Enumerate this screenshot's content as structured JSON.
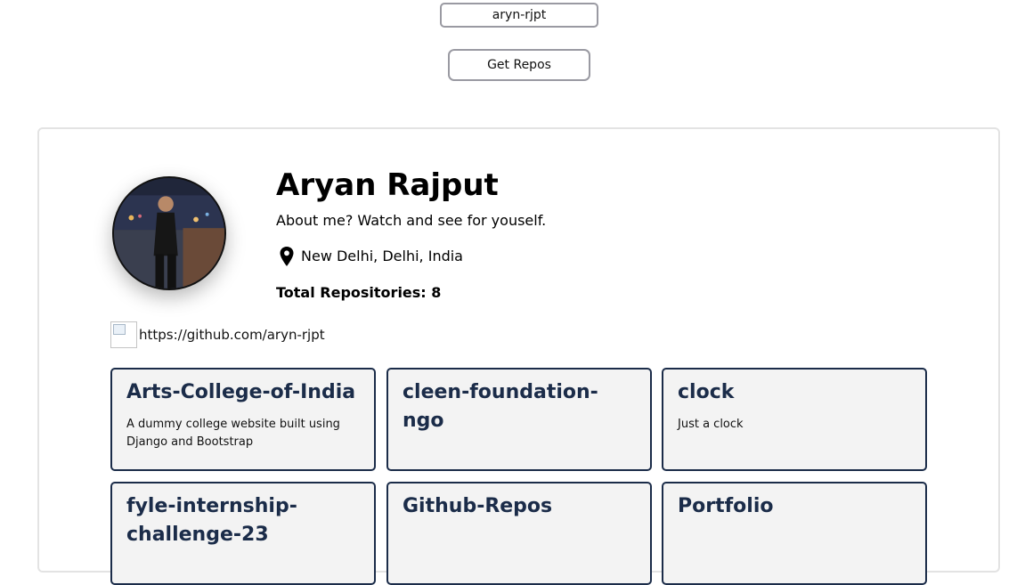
{
  "search": {
    "value": "aryn-rjpt"
  },
  "get_repos_button": {
    "label": "Get Repos"
  },
  "profile": {
    "name": "Aryan Rajput",
    "bio": "About me? Watch and see for youself.",
    "location": "New Delhi, Delhi, India",
    "total_repos": "Total Repositories: 8",
    "github_url": "https://github.com/aryn-rjpt"
  },
  "repos": [
    {
      "name": "Arts-College-of-India",
      "description": "A dummy college website built using Django and Bootstrap"
    },
    {
      "name": "cleen-foundation-ngo",
      "description": ""
    },
    {
      "name": "clock",
      "description": "Just a clock"
    },
    {
      "name": "fyle-internship-challenge-23",
      "description": ""
    },
    {
      "name": "Github-Repos",
      "description": ""
    },
    {
      "name": "Portfolio",
      "description": ""
    }
  ],
  "colors": {
    "repo_border": "#1b2c49",
    "repo_background": "#f3f3f3",
    "button_border": "#9a9aa2"
  }
}
